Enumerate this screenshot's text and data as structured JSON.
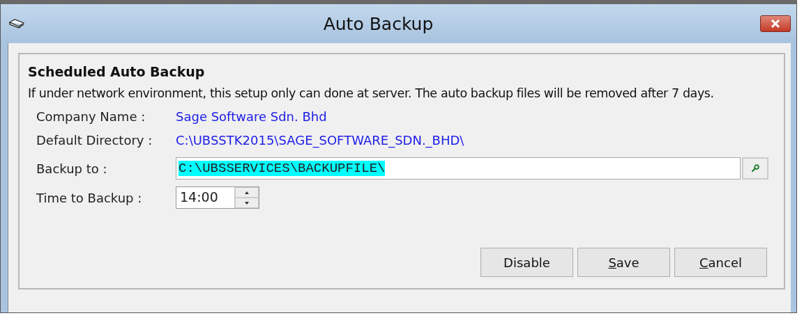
{
  "window": {
    "title": "Auto Backup"
  },
  "group": {
    "title": "Scheduled Auto Backup",
    "note": "If under network environment, this setup only can done at server. The auto backup files will be removed after 7 days."
  },
  "info": [
    {
      "label": "Company Name :",
      "value": "Sage Software Sdn. Bhd"
    },
    {
      "label": "Default Directory :",
      "value": "C:\\UBSSTK2015\\SAGE_SOFTWARE_SDN._BHD\\"
    }
  ],
  "backup_to": {
    "label": "Backup to :",
    "value": "C:\\UBSSERVICES\\BACKUPFILE\\",
    "text_selected": true
  },
  "time": {
    "label": "Time to Backup :",
    "value": "14:00"
  },
  "buttons": [
    {
      "label": "Disable",
      "mnemonic": false
    },
    {
      "label": "Save",
      "mnemonic": true
    },
    {
      "label": "Cancel",
      "mnemonic": true
    }
  ]
}
